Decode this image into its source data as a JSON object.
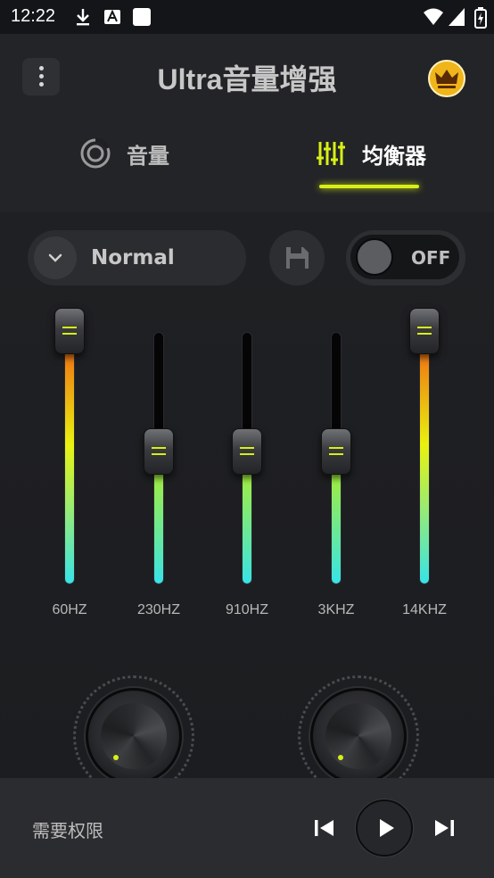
{
  "status_bar": {
    "time": "12:22",
    "icons": [
      "download-icon",
      "a-icon",
      "square-icon",
      "wifi-icon",
      "signal-icon",
      "battery-icon"
    ]
  },
  "header": {
    "title": "Ultra音量增强",
    "menu_icon": "more-vert-icon",
    "premium_icon": "crown-icon"
  },
  "tabs": [
    {
      "label": "音量",
      "icon": "volume-ring-icon",
      "active": false
    },
    {
      "label": "均衡器",
      "icon": "equalizer-icon",
      "active": true
    }
  ],
  "equalizer": {
    "preset_label": "Normal",
    "save_icon": "save-icon",
    "toggle_label": "OFF",
    "toggle_on": false,
    "bands": [
      {
        "label": "60HZ",
        "level": 1.0
      },
      {
        "label": "230HZ",
        "level": 0.5
      },
      {
        "label": "910HZ",
        "level": 0.5
      },
      {
        "label": "3KHZ",
        "level": 0.5
      },
      {
        "label": "14KHZ",
        "level": 1.0
      }
    ]
  },
  "knobs": [
    {
      "name": "bass-boost-knob",
      "level": 0
    },
    {
      "name": "virtualizer-knob",
      "level": 0
    }
  ],
  "bottom_bar": {
    "permission_text": "需要权限",
    "controls": [
      "previous-icon",
      "play-icon",
      "next-icon"
    ]
  },
  "colors": {
    "accent": "#d8ef16",
    "background": "#1f2023",
    "gradient_top": "#f05a14",
    "gradient_mid": "#e9f20f",
    "gradient_bottom": "#38e3e8"
  }
}
